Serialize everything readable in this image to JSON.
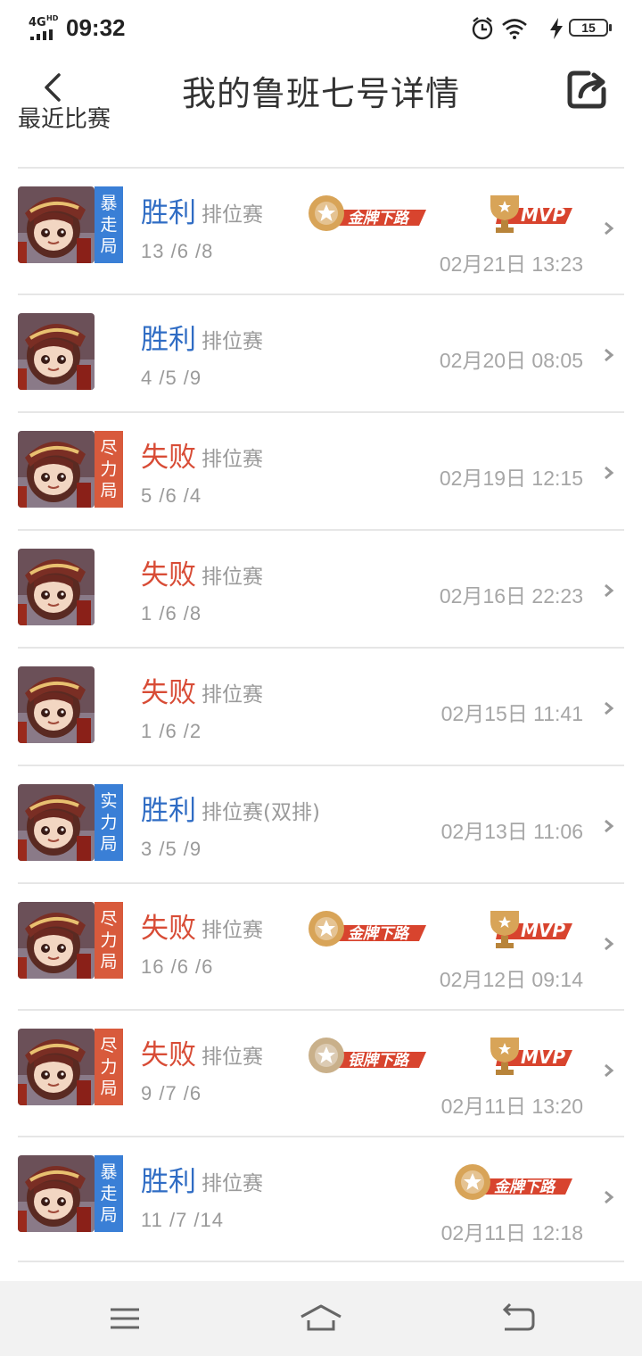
{
  "status_bar": {
    "network": "4G",
    "network_sup": "HD",
    "time": "09:32",
    "battery": "15"
  },
  "header": {
    "title": "我的鲁班七号详情"
  },
  "section": {
    "title": "最近比赛"
  },
  "colors": {
    "win": "#2f6cc4",
    "lose": "#d84c36",
    "tag_blue": "#3a7fd6",
    "tag_red": "#d85a3c"
  },
  "matches": [
    {
      "result": "胜利",
      "mode": "排位赛",
      "kda": "13 /6 /8",
      "date": "02月21日 13:23",
      "tag": "暴走局",
      "tag_color": "blue",
      "medal": "金牌下路",
      "mvp": "MVP"
    },
    {
      "result": "胜利",
      "mode": "排位赛",
      "kda": "4 /5 /9",
      "date": "02月20日 08:05",
      "tag": "",
      "tag_color": "",
      "medal": "",
      "mvp": ""
    },
    {
      "result": "失败",
      "mode": "排位赛",
      "kda": "5 /6 /4",
      "date": "02月19日 12:15",
      "tag": "尽力局",
      "tag_color": "red",
      "medal": "",
      "mvp": ""
    },
    {
      "result": "失败",
      "mode": "排位赛",
      "kda": "1 /6 /8",
      "date": "02月16日 22:23",
      "tag": "",
      "tag_color": "",
      "medal": "",
      "mvp": ""
    },
    {
      "result": "失败",
      "mode": "排位赛",
      "kda": "1 /6 /2",
      "date": "02月15日 11:41",
      "tag": "",
      "tag_color": "",
      "medal": "",
      "mvp": ""
    },
    {
      "result": "胜利",
      "mode": "排位赛(双排)",
      "kda": "3 /5 /9",
      "date": "02月13日 11:06",
      "tag": "实力局",
      "tag_color": "blue",
      "medal": "",
      "mvp": ""
    },
    {
      "result": "失败",
      "mode": "排位赛",
      "kda": "16 /6 /6",
      "date": "02月12日 09:14",
      "tag": "尽力局",
      "tag_color": "red",
      "medal": "金牌下路",
      "mvp": "MVP"
    },
    {
      "result": "失败",
      "mode": "排位赛",
      "kda": "9 /7 /6",
      "date": "02月11日 13:20",
      "tag": "尽力局",
      "tag_color": "red",
      "medal": "银牌下路",
      "mvp": "MVP"
    },
    {
      "result": "胜利",
      "mode": "排位赛",
      "kda": "11 /7 /14",
      "date": "02月11日 12:18",
      "tag": "暴走局",
      "tag_color": "blue",
      "medal": "金牌下路",
      "mvp": ""
    }
  ],
  "nav": {
    "items": [
      "menu-icon",
      "home-icon",
      "back-icon"
    ]
  }
}
